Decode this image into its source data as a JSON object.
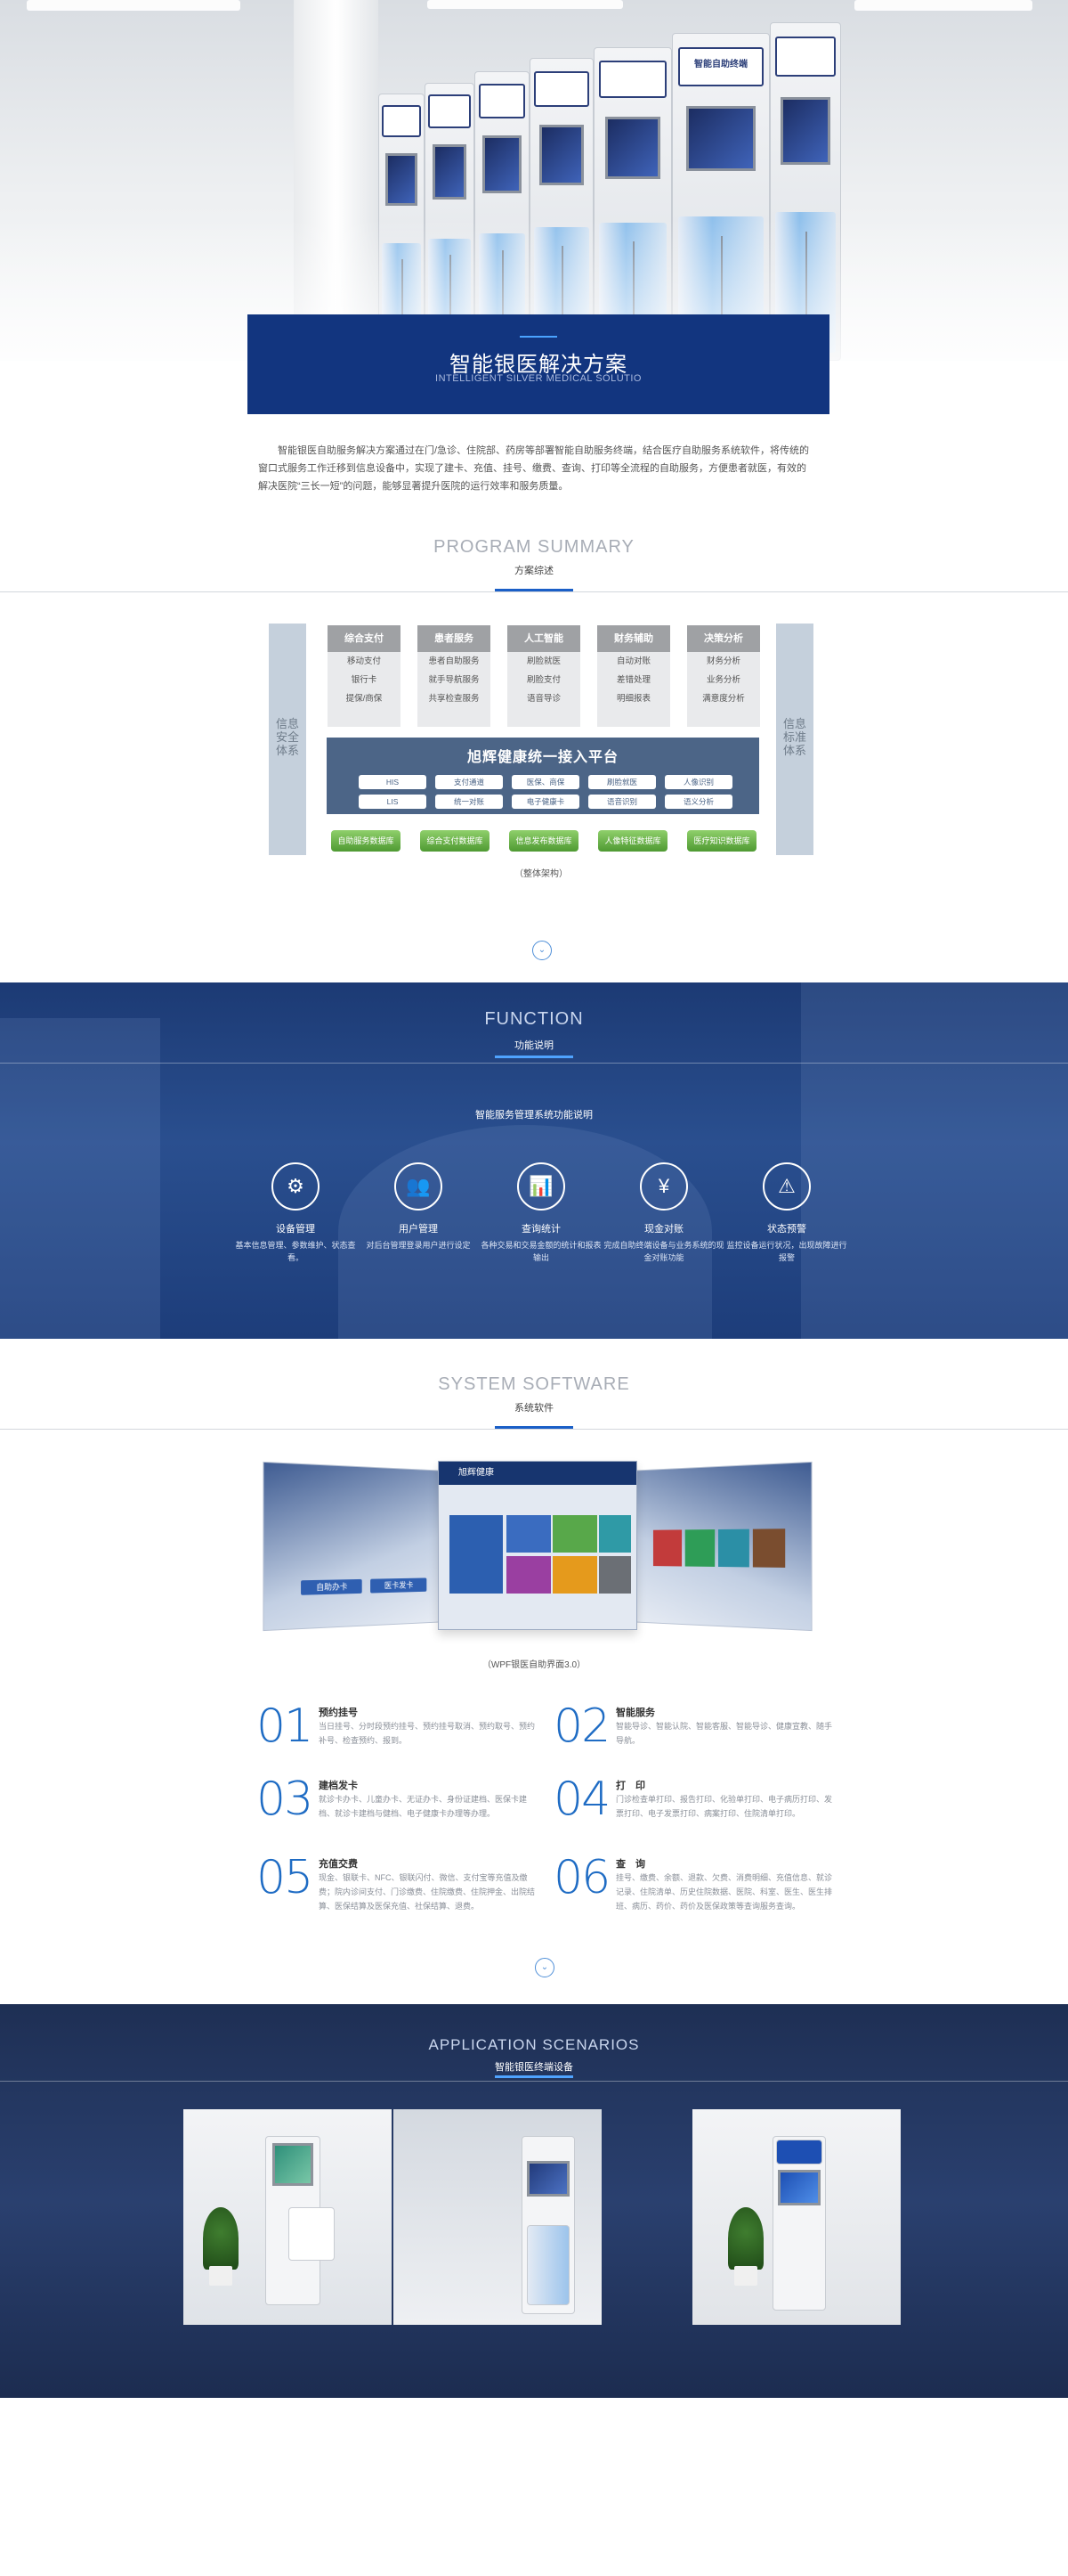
{
  "hero": {
    "title": "智能银医解决方案",
    "subtitle": "INTELLIGENT SILVER MEDICAL SOLUTIO",
    "kiosk_sign": "智能自助终端"
  },
  "intro": "智能银医自助服务解决方案通过在门/急诊、住院部、药房等部署智能自助服务终端，结合医疗自助服务系统软件，将传统的窗口式服务工作迁移到信息设备中，实现了建卡、充值、挂号、缴费、查询、打印等全流程的自助服务，方便患者就医，有效的解决医院“三长一短”的问题，能够显著提升医院的运行效率和服务质量。",
  "summary": {
    "en": "PROGRAM SUMMARY",
    "cn": "方案综述",
    "left_side": "信息安全体系",
    "right_side": "信息标准体系",
    "columns": [
      {
        "title": "综合支付",
        "items": [
          "移动支付",
          "银行卡",
          "提保/商保"
        ]
      },
      {
        "title": "患者服务",
        "items": [
          "患者自助服务",
          "就手导航服务",
          "共享检查服务"
        ]
      },
      {
        "title": "人工智能",
        "items": [
          "刷脸就医",
          "刷脸支付",
          "语音导诊"
        ]
      },
      {
        "title": "财务辅助",
        "items": [
          "自动对账",
          "差错处理",
          "明细报表"
        ]
      },
      {
        "title": "决策分析",
        "items": [
          "财务分析",
          "业务分析",
          "满意度分析"
        ]
      }
    ],
    "platform_title": "旭辉健康统一接入平台",
    "platform_pills": [
      [
        "HIS",
        "支付通道",
        "医保、商保",
        "刷脸就医",
        "人像识别"
      ],
      [
        "LIS",
        "统一对账",
        "电子健康卡",
        "语音识别",
        "语义分析"
      ]
    ],
    "databases": [
      "自助服务数据库",
      "综合支付数据库",
      "信息发布数据库",
      "人像特征数据库",
      "医疗知识数据库"
    ],
    "caption": "（整体架构）"
  },
  "function": {
    "en": "FUNCTION",
    "cn": "功能说明",
    "lead": "智能服务管理系统功能说明",
    "items": [
      {
        "icon": "gears-icon",
        "glyph": "⚙",
        "title": "设备管理",
        "desc": "基本信息管理、参数维护、状态查看。"
      },
      {
        "icon": "users-icon",
        "glyph": "👥",
        "title": "用户管理",
        "desc": "对后台管理登录用户进行设定"
      },
      {
        "icon": "chart-icon",
        "glyph": "📊",
        "title": "查询统计",
        "desc": "各种交易和交易金额的统计和报表输出"
      },
      {
        "icon": "cash-icon",
        "glyph": "¥",
        "title": "现金对账",
        "desc": "完成自助终端设备与业务系统的现金对账功能"
      },
      {
        "icon": "alarm-icon",
        "glyph": "⚠",
        "title": "状态预警",
        "desc": "监控设备运行状况，出现故障进行报警"
      }
    ]
  },
  "software": {
    "en": "SYSTEM SOFTWARE",
    "cn": "系统软件",
    "brand": "旭辉健康",
    "left_screen_btns": [
      "自助办卡",
      "医卡发卡"
    ],
    "caption": "（WPF银医自助界面3.0）",
    "features": [
      {
        "num": "01",
        "title": "预约挂号",
        "desc": "当日挂号、分时段预约挂号、预约挂号取消、预约取号、预约补号、检查预约、报到。"
      },
      {
        "num": "02",
        "title": "智能服务",
        "desc": "智能导诊、智能认院、智能客服、智能导诊、健康宣教、随手导航。"
      },
      {
        "num": "03",
        "title": "建档发卡",
        "desc": "就诊卡办卡、儿童办卡、无证办卡、身份证建档、医保卡建档、就诊卡建档与健档、电子健康卡办理等办理。"
      },
      {
        "num": "04",
        "title": "打　印",
        "desc": "门诊检查单打印、报告打印、化验单打印、电子病历打印、发票打印、电子发票打印、病案打印、住院清单打印。"
      },
      {
        "num": "05",
        "title": "充值交费",
        "desc": "现金、银联卡、NFC、银联闪付、微信、支付宝等充值及缴费；院内诊间支付、门诊缴费、住院缴费、住院押金、出院结算、医保结算及医保充值、社保结算、退费。"
      },
      {
        "num": "06",
        "title": "查　询",
        "desc": "挂号、缴费、余额、退款、欠费、消费明细、充值信息、就诊记录、住院清单、历史住院数据、医院、科室、医生、医生排班、病历、药价、药价及医保政策等查询服务查询。"
      }
    ]
  },
  "application": {
    "en": "APPLICATION SCENARIOS",
    "cn": "智能银医终端设备"
  }
}
